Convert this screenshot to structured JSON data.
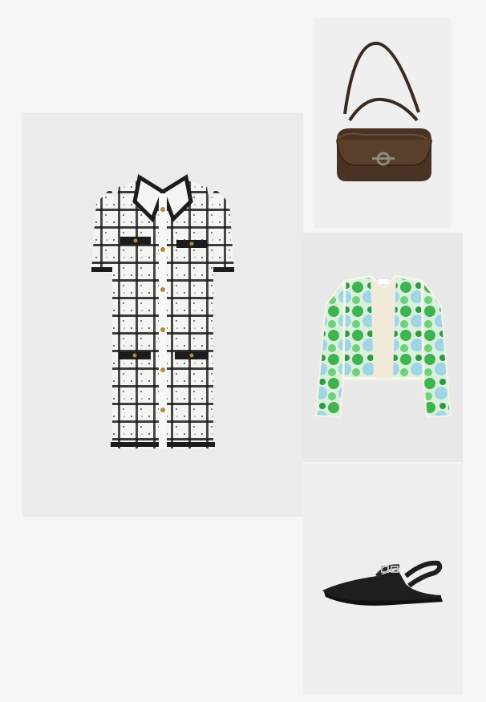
{
  "board": {
    "items": [
      {
        "id": "dress",
        "name": "tweed-shirt-dress"
      },
      {
        "id": "bag",
        "name": "brown-shoulder-bag"
      },
      {
        "id": "jacket",
        "name": "floral-quilted-jacket"
      },
      {
        "id": "shoe",
        "name": "black-slingback-flat"
      }
    ]
  },
  "colors": {
    "page_background": "#f5f5f5",
    "tile_background": "#ebebeb",
    "tweed_white": "#f4f4f2",
    "tweed_black": "#1c1c1c",
    "bag_brown": "#4a3324",
    "jacket_green": "#3fb34f",
    "jacket_blue": "#9fd5e6",
    "shoe_black": "#1e1e20"
  }
}
